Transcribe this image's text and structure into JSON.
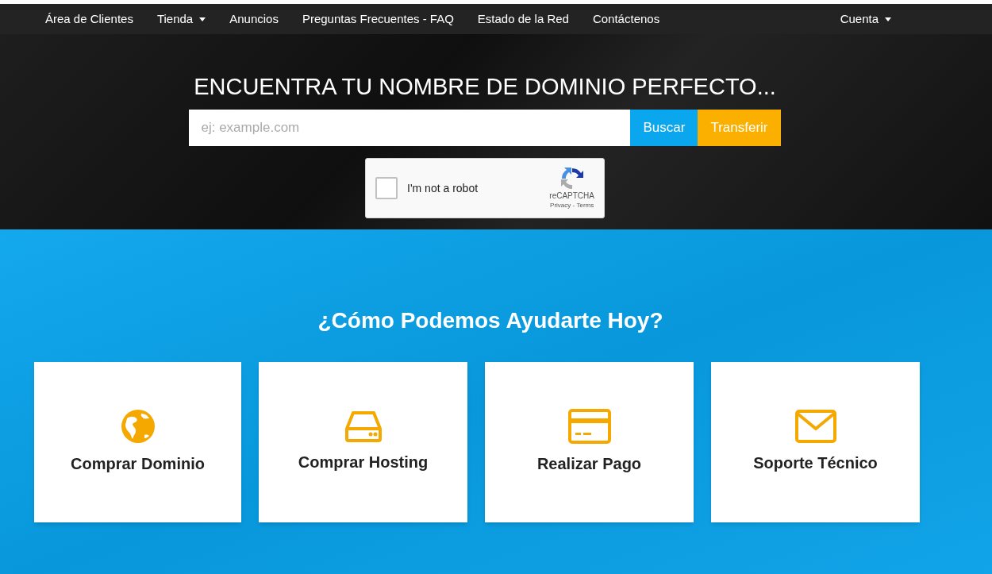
{
  "nav": {
    "items": [
      {
        "label": "Área de Clientes",
        "kind": "link"
      },
      {
        "label": "Tienda",
        "kind": "dropdown"
      },
      {
        "label": "Anuncios",
        "kind": "link"
      },
      {
        "label": "Preguntas Frecuentes - FAQ",
        "kind": "link"
      },
      {
        "label": "Estado de la Red",
        "kind": "link"
      },
      {
        "label": "Contáctenos",
        "kind": "link"
      }
    ],
    "account": {
      "label": "Cuenta",
      "kind": "dropdown"
    }
  },
  "hero": {
    "title": "ENCUENTRA TU NOMBRE DE DOMINIO PERFECTO...",
    "search": {
      "placeholder": "ej: example.com"
    },
    "buttons": [
      {
        "label": "Buscar",
        "kind": "search"
      },
      {
        "label": "Transferir",
        "kind": "transfer"
      }
    ],
    "captcha": {
      "label": "I'm not a robot",
      "checked": false,
      "brand": "reCAPTCHA",
      "privacy": "Privacy",
      "separator": " - ",
      "terms": "Terms"
    }
  },
  "help": {
    "title": "¿Cómo Podemos Ayudarte Hoy?",
    "cards": [
      {
        "label": "Comprar Dominio",
        "kind": "globe"
      },
      {
        "label": "Comprar Hosting",
        "kind": "drive"
      },
      {
        "label": "Realizar Pago",
        "kind": "card"
      },
      {
        "label": "Soporte Técnico",
        "kind": "mail"
      }
    ]
  }
}
